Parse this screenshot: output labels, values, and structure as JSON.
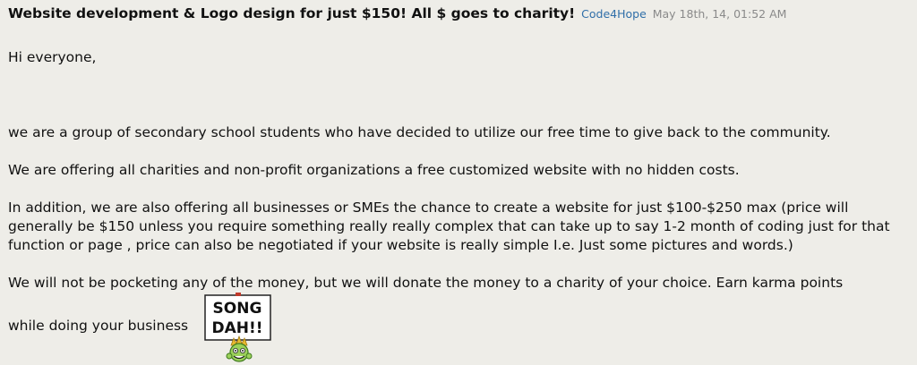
{
  "post": {
    "title": "Website development & Logo design for just $150! All $ goes to charity!",
    "author": "Code4Hope",
    "date": "May 18th, 14, 01:52 AM",
    "greeting": "Hi everyone,",
    "paragraphs": [
      "we are a group of secondary school students who have decided to utilize our free time to give back to the community.",
      "We are offering all charities and non-profit organizations a free customized website with no hidden costs.",
      "In addition, we are also offering all businesses or SMEs the chance to create a website for just $100-$250 max (price will generally be $150 unless you require something really really complex that can take up to say 1-2 month of coding just for that function or page , price can also be negotiated if your website is really simple I.e. Just some pictures and words.)",
      "We will not be pocketing any of the money, but we will donate the money to a charity of your choice. Earn karma points"
    ],
    "closing": "while doing your business",
    "emote": {
      "sign_line1": "SONG",
      "sign_line2": "DAH!!",
      "icon": "song-dah-sign-emote-icon",
      "colors": {
        "sign_bg": "#ffffff",
        "face": "#9bd15a",
        "hair": "#e8b830"
      }
    }
  }
}
